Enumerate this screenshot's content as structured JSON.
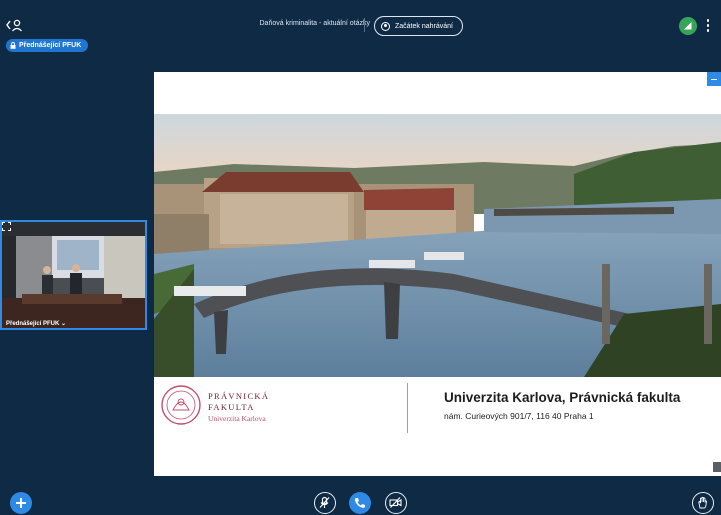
{
  "header": {
    "meeting_title": "Daňová kriminalita - aktuální otázky",
    "record_label": "Začátek nahrávání",
    "presenter_chip": "Přednášející PFUK"
  },
  "webcam": {
    "name": "Přednášející PFUK"
  },
  "slide": {
    "logo_line1": "PRÁVNICKÁ",
    "logo_line2": "FAKULTA",
    "logo_line3": "Univerzita Karlova",
    "heading": "Univerzita Karlova, Právnická fakulta",
    "address": "nám. Curieových 901/7, 116 40 Praha 1"
  },
  "icons": {
    "users": "users-icon",
    "lock": "lock-icon",
    "record": "record-icon",
    "connection": "connection-status-icon",
    "options": "more-options-icon",
    "actions": "plus-icon",
    "audio": "microphone-muted-icon",
    "phone": "phone-icon",
    "video": "camera-off-icon",
    "hand": "raise-hand-icon"
  },
  "colors": {
    "background": "#0e2a45",
    "accent": "#2f8ae6",
    "status_green": "#36a55a",
    "brand_burgundy": "#6f2233"
  }
}
